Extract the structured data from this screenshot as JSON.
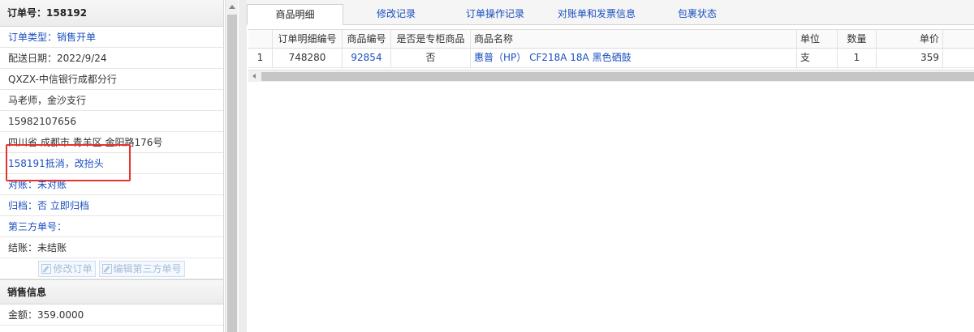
{
  "order": {
    "header_label": "订单号：",
    "number": "158192",
    "rows": [
      {
        "text": "订单类型：销售开单",
        "blue": true
      },
      {
        "text": "配送日期：2022/9/24",
        "blue": false
      },
      {
        "text": "QXZX-中信银行成都分行",
        "blue": false
      },
      {
        "text": "马老师，金沙支行",
        "blue": false
      },
      {
        "text": "15982107656",
        "blue": false
      },
      {
        "text": "四川省 成都市 青羊区 金阳路176号",
        "blue": false
      },
      {
        "text": "158191抵消，改抬头",
        "blue": true
      },
      {
        "text": "对账：未对账",
        "blue": true
      },
      {
        "text": "归档：否 立即归档",
        "blue": true
      },
      {
        "text": "第三方单号：",
        "blue": true
      },
      {
        "text": "结账：未结账",
        "blue": false
      }
    ],
    "edit_order_button": "修改订单",
    "edit_third_party_button": "编辑第三方单号"
  },
  "sales": {
    "section_title": "销售信息",
    "amount": "金额：359.0000"
  },
  "tabs": [
    {
      "label": "商品明细",
      "active": true
    },
    {
      "label": "修改记录",
      "active": false
    },
    {
      "label": "订单操作记录",
      "active": false
    },
    {
      "label": "对账单和发票信息",
      "active": false
    },
    {
      "label": "包裹状态",
      "active": false
    }
  ],
  "grid": {
    "columns": [
      "订单明细编号",
      "商品编号",
      "是否是专柜商品",
      "商品名称",
      "单位",
      "数量",
      "单价"
    ],
    "rows": [
      {
        "index": "1",
        "detail_no": "748280",
        "product_code": "92854",
        "is_counter": "否",
        "name": "惠普（HP） CF218A 18A 黑色硒鼓",
        "unit": "支",
        "qty": "1",
        "price": "359"
      }
    ]
  },
  "annotation": {
    "color": "#e8322e"
  }
}
